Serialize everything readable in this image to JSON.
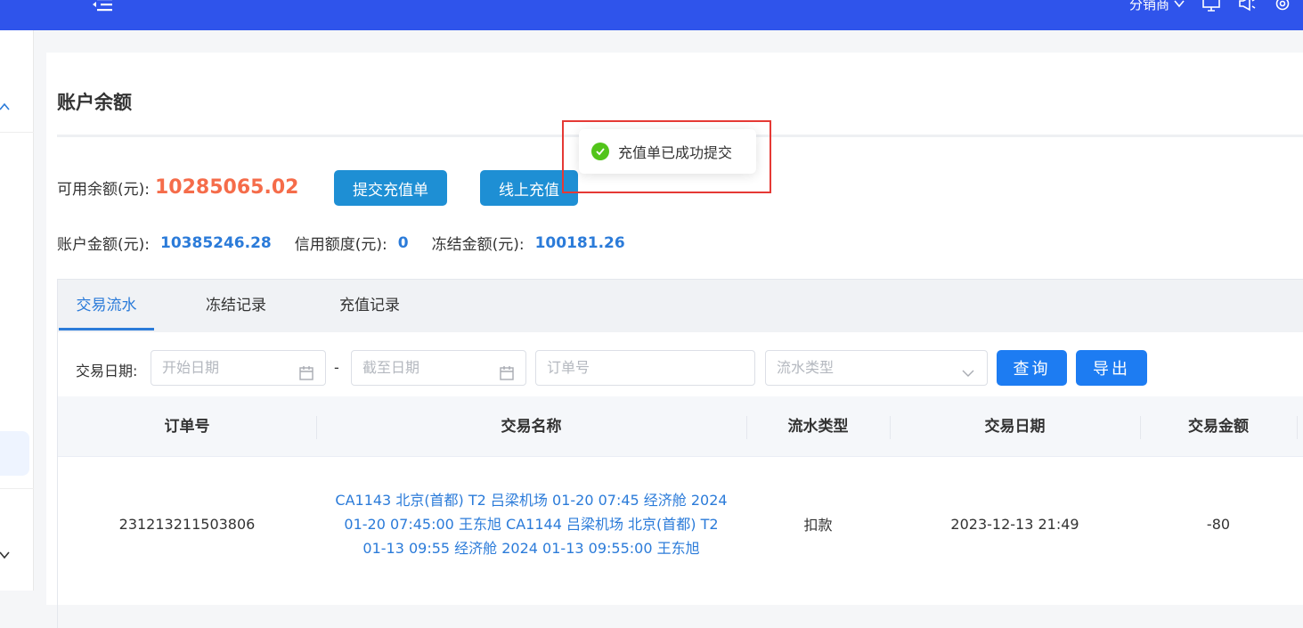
{
  "header": {
    "role_label": "分销商",
    "icons": [
      "menu-fold-icon",
      "chevron-down-icon",
      "monitor-icon",
      "megaphone-icon",
      "gear-icon"
    ]
  },
  "page": {
    "title": "账户余额"
  },
  "balance": {
    "available_label": "可用余额(元):",
    "available_value": "10285065.02",
    "submit_button": "提交充值单",
    "online_button": "线上充值"
  },
  "amounts": [
    {
      "label": "账户金额(元):",
      "value": "10385246.28"
    },
    {
      "label": "信用额度(元):",
      "value": "0"
    },
    {
      "label": "冻结金额(元):",
      "value": "100181.26"
    }
  ],
  "tabs": [
    {
      "label": "交易流水",
      "active": true
    },
    {
      "label": "冻结记录",
      "active": false
    },
    {
      "label": "充值记录",
      "active": false
    }
  ],
  "filters": {
    "date_label": "交易日期:",
    "start_placeholder": "开始日期",
    "range_separator": "-",
    "end_placeholder": "截至日期",
    "order_placeholder": "订单号",
    "type_placeholder": "流水类型",
    "query_button": "查询",
    "export_button": "导出"
  },
  "table": {
    "columns": [
      "订单号",
      "交易名称",
      "流水类型",
      "交易日期",
      "交易金额"
    ],
    "rows": [
      {
        "order_no": "231213211503806",
        "name": "CA1143 北京(首都) T2 吕梁机场 01-20 07:45 经济舱 2024 01-20 07:45:00 王东旭 CA1144 吕梁机场 北京(首都) T2 01-13 09:55 经济舱 2024 01-13 09:55:00 王东旭",
        "type": "扣款",
        "date": "2023-12-13 21:49",
        "amount": "-80"
      }
    ]
  },
  "toast": {
    "message": "充值单已成功提交"
  },
  "colors": {
    "header_bg": "#2f54eb",
    "accent_blue": "#2b7bd9",
    "balance_red": "#f56c4a",
    "success_green": "#52c41a",
    "highlight_red": "#e53935"
  }
}
